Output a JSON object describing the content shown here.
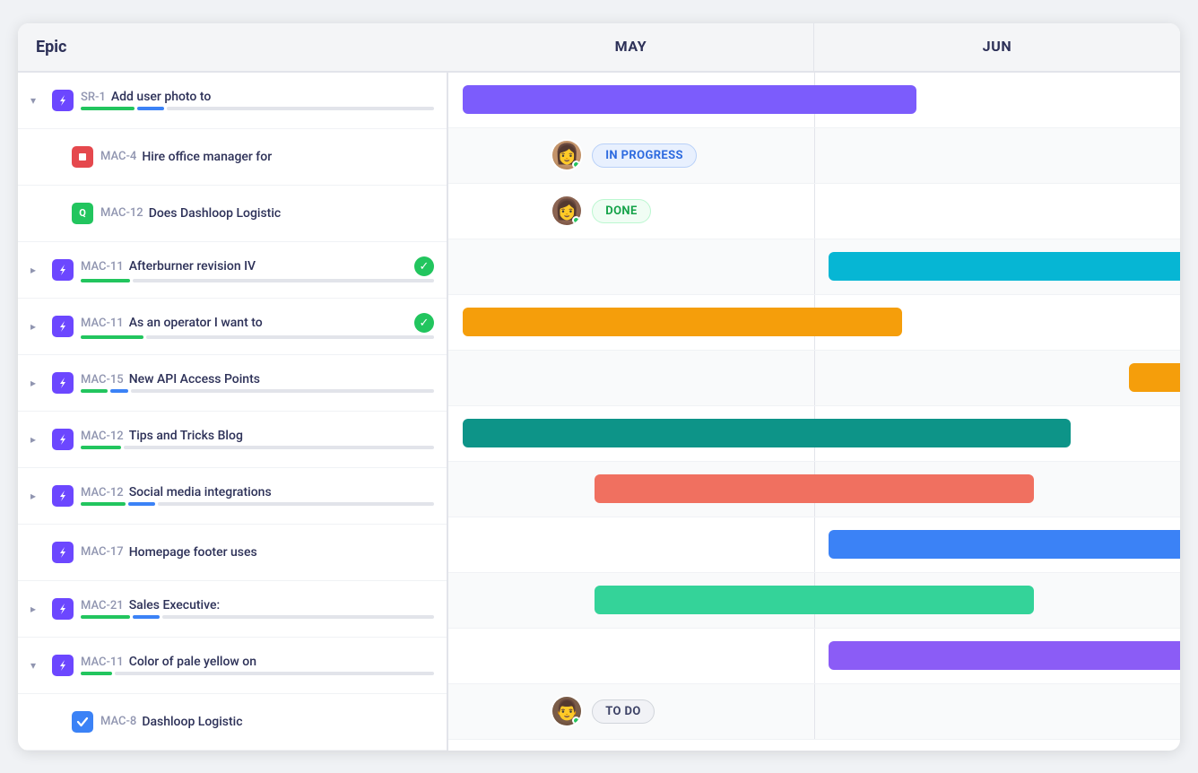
{
  "header": {
    "epic_label": "Epic",
    "may_label": "MAY",
    "jun_label": "JUN"
  },
  "rows": [
    {
      "id": "row-sr1",
      "indent": false,
      "expandable": true,
      "expanded": true,
      "icon": "lightning",
      "epic_id": "SR-1",
      "title": "Add user photo to",
      "progress_green": 60,
      "progress_blue": 30,
      "show_bar": true,
      "bar_color": "#7c5cfc",
      "bar_left_pct": 2,
      "bar_width_pct": 62,
      "bar_label": "",
      "done_badge": false
    },
    {
      "id": "row-mac4",
      "indent": true,
      "expandable": false,
      "expanded": false,
      "icon": "red-sq",
      "epic_id": "MAC-4",
      "title": "Hire office manager for",
      "progress_green": 0,
      "progress_blue": 0,
      "show_avatar": true,
      "avatar_face": "face-1",
      "status": "IN PROGRESS",
      "status_type": "in-progress",
      "bar_left_pct": 26,
      "bar_width_pct": 0,
      "done_badge": false
    },
    {
      "id": "row-mac12a",
      "indent": true,
      "expandable": false,
      "expanded": false,
      "icon": "green-sq",
      "epic_id": "MAC-12",
      "title": "Does Dashloop Logistic",
      "progress_green": 0,
      "progress_blue": 0,
      "show_avatar": true,
      "avatar_face": "face-2",
      "status": "DONE",
      "status_type": "done",
      "bar_left_pct": 26,
      "bar_width_pct": 0,
      "done_badge": false
    },
    {
      "id": "row-mac11a",
      "indent": false,
      "expandable": true,
      "expanded": false,
      "icon": "lightning",
      "epic_id": "MAC-11",
      "title": "Afterburner revision IV",
      "progress_green": 55,
      "progress_blue": 0,
      "show_bar": true,
      "bar_color": "#06b6d4",
      "bar_left_pct": 52,
      "bar_width_pct": 56,
      "bar_label": "",
      "done_badge": true
    },
    {
      "id": "row-mac11b",
      "indent": false,
      "expandable": true,
      "expanded": false,
      "icon": "lightning",
      "epic_id": "MAC-11",
      "title": "As an operator I want to",
      "progress_green": 70,
      "progress_blue": 0,
      "show_bar": true,
      "bar_color": "#f59e0b",
      "bar_left_pct": 2,
      "bar_width_pct": 60,
      "bar_label": "",
      "done_badge": true
    },
    {
      "id": "row-mac15",
      "indent": false,
      "expandable": true,
      "expanded": false,
      "icon": "lightning",
      "epic_id": "MAC-15",
      "title": "New API Access Points",
      "progress_green": 30,
      "progress_blue": 20,
      "show_bar": true,
      "bar_color": "#f59e0b",
      "bar_left_pct": 93,
      "bar_width_pct": 12,
      "bar_label": "",
      "done_badge": false
    },
    {
      "id": "row-mac12b",
      "indent": false,
      "expandable": true,
      "expanded": false,
      "icon": "lightning",
      "epic_id": "MAC-12",
      "title": "Tips and Tricks Blog",
      "progress_green": 45,
      "progress_blue": 0,
      "show_bar": true,
      "bar_color": "#0d9488",
      "bar_left_pct": 2,
      "bar_width_pct": 83,
      "bar_label": "",
      "done_badge": false
    },
    {
      "id": "row-mac12c",
      "indent": false,
      "expandable": true,
      "expanded": false,
      "icon": "lightning",
      "epic_id": "MAC-12",
      "title": "Social media integrations",
      "progress_green": 50,
      "progress_blue": 30,
      "show_bar": true,
      "bar_color": "#f07060",
      "bar_left_pct": 20,
      "bar_width_pct": 60,
      "bar_label": "",
      "done_badge": false
    },
    {
      "id": "row-mac17",
      "indent": false,
      "expandable": false,
      "expanded": false,
      "icon": "lightning",
      "epic_id": "MAC-17",
      "title": "Homepage footer uses",
      "progress_green": 0,
      "progress_blue": 0,
      "show_bar": true,
      "bar_color": "#3b82f6",
      "bar_left_pct": 52,
      "bar_width_pct": 55,
      "bar_label": "",
      "done_badge": false
    },
    {
      "id": "row-mac21",
      "indent": false,
      "expandable": true,
      "expanded": false,
      "icon": "lightning",
      "epic_id": "MAC-21",
      "title": "Sales Executive:",
      "progress_green": 55,
      "progress_blue": 30,
      "show_bar": true,
      "bar_color": "#34d399",
      "bar_left_pct": 20,
      "bar_width_pct": 60,
      "bar_label": "",
      "done_badge": false
    },
    {
      "id": "row-mac11c",
      "indent": false,
      "expandable": true,
      "expanded": true,
      "icon": "lightning",
      "epic_id": "MAC-11",
      "title": "Color of pale yellow on",
      "progress_green": 35,
      "progress_blue": 0,
      "show_bar": true,
      "bar_color": "#8b5cf6",
      "bar_left_pct": 52,
      "bar_width_pct": 55,
      "bar_label": "",
      "done_badge": false
    },
    {
      "id": "row-mac8",
      "indent": true,
      "expandable": false,
      "expanded": false,
      "icon": "blue-check",
      "epic_id": "MAC-8",
      "title": "Dashloop Logistic",
      "progress_green": 0,
      "progress_blue": 0,
      "show_avatar": true,
      "avatar_face": "face-3",
      "status": "TO DO",
      "status_type": "todo",
      "bar_left_pct": 46,
      "bar_width_pct": 0,
      "done_badge": false
    }
  ]
}
